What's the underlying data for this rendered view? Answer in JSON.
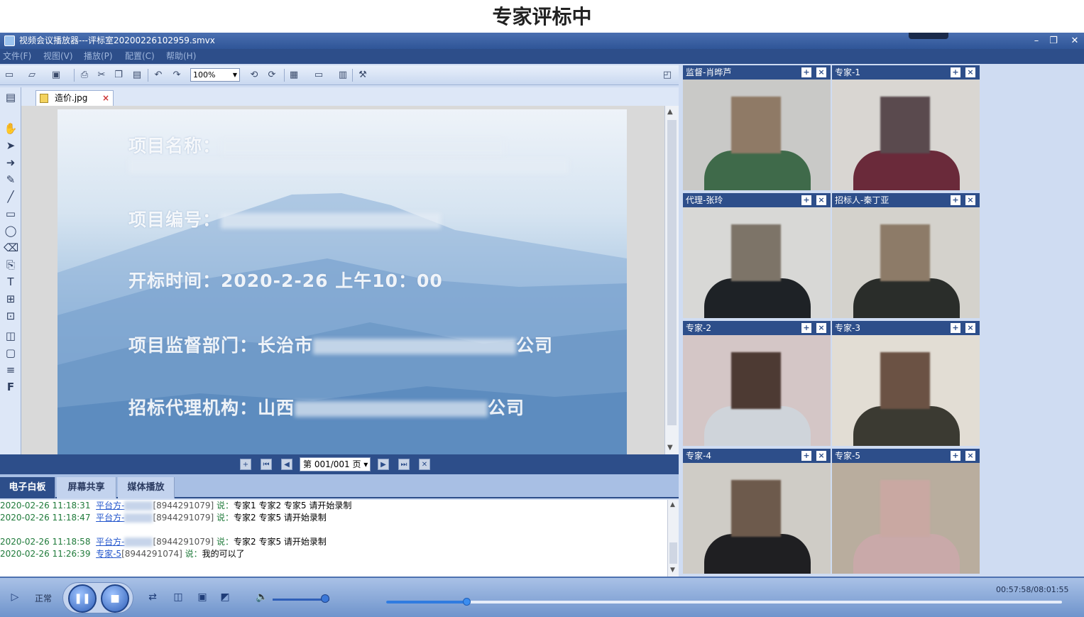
{
  "caption": "专家评标中",
  "window": {
    "title": "视频会议播放器---评标室20200226102959.smvx",
    "controls": {
      "minimize": "–",
      "maximize": "❐",
      "close": "✕"
    }
  },
  "menu": [
    "文件(F)",
    "视图(V)",
    "播放(P)",
    "配置(C)",
    "帮助(H)"
  ],
  "toolbar": {
    "zoom": "100%"
  },
  "document_tab": {
    "name": "造价.jpg",
    "close": "×"
  },
  "slide": {
    "line1_label": "项目名称：",
    "line2_label": "项目编号：",
    "line3": "开标时间：2020-2-26 上午10：00",
    "line4_label": "项目监督部门：长治市",
    "line4_suffix": "公司",
    "line5_label": "招标代理机构：山西",
    "line5_suffix": "公司"
  },
  "page_nav": {
    "page_display": "第 001/001 页"
  },
  "mode_tabs": [
    {
      "label": "电子白板",
      "active": true
    },
    {
      "label": "屏幕共享",
      "active": false
    },
    {
      "label": "媒体播放",
      "active": false
    }
  ],
  "chat": [
    {
      "ts": "2020-02-26 11:18:31",
      "who": "平台方-",
      "id": "[8944291079]",
      "say": "说：",
      "msg": "专家1 专家2  专家5 请开始录制",
      "blurred": true
    },
    {
      "ts": "2020-02-26 11:18:47",
      "who": "平台方-",
      "id": "[8944291079]",
      "say": "说：",
      "msg": "专家2  专家5 请开始录制",
      "blurred": true
    },
    {
      "ts": "2020-02-26 11:18:58",
      "who": "平台方-",
      "id": "[8944291079]",
      "say": "说：",
      "msg": "专家2  专家5 请开始录制",
      "blurred": true
    },
    {
      "ts": "2020-02-26 11:26:39",
      "who": "专家-5",
      "id": "[8944291074]",
      "say": "说：",
      "msg": "我的可以了",
      "blurred": false
    }
  ],
  "videos": [
    {
      "name": "监督-肖晔芦",
      "bg": "#c9c9c7",
      "cloth": "#3f6a4a",
      "skin": "#8f7a66"
    },
    {
      "name": "专家-1",
      "bg": "#d9d6d2",
      "cloth": "#6a2a3a",
      "skin": "#5a4a4e"
    },
    {
      "name": "代理-张玲",
      "bg": "#d8d8d6",
      "cloth": "#1e2226",
      "skin": "#7d7468"
    },
    {
      "name": "招标人-秦丁亚",
      "bg": "#d4d2cc",
      "cloth": "#2a2d2a",
      "skin": "#8d7b68"
    },
    {
      "name": "专家-2",
      "bg": "#d4c6c6",
      "cloth": "#cfd4da",
      "skin": "#4d3a33"
    },
    {
      "name": "专家-3",
      "bg": "#e2ddd4",
      "cloth": "#3b3a32",
      "skin": "#6b5244"
    },
    {
      "name": "专家-4",
      "bg": "#cfccc6",
      "cloth": "#1f1f22",
      "skin": "#6d5a4c"
    },
    {
      "name": "专家-5",
      "bg": "#b9ad9e",
      "cloth": "#c9a9a9",
      "skin": "#c9a8a2"
    }
  ],
  "video_buttons": {
    "pin": "+",
    "close": "×"
  },
  "player": {
    "mode": "正常",
    "time": "00:57:58/08:01:55",
    "progress": 0.12,
    "volume": 0.93
  },
  "colors": {
    "chrome_dark": "#2d4e8a",
    "chrome_light": "#cfdcf2",
    "accent": "#2f7be0"
  }
}
